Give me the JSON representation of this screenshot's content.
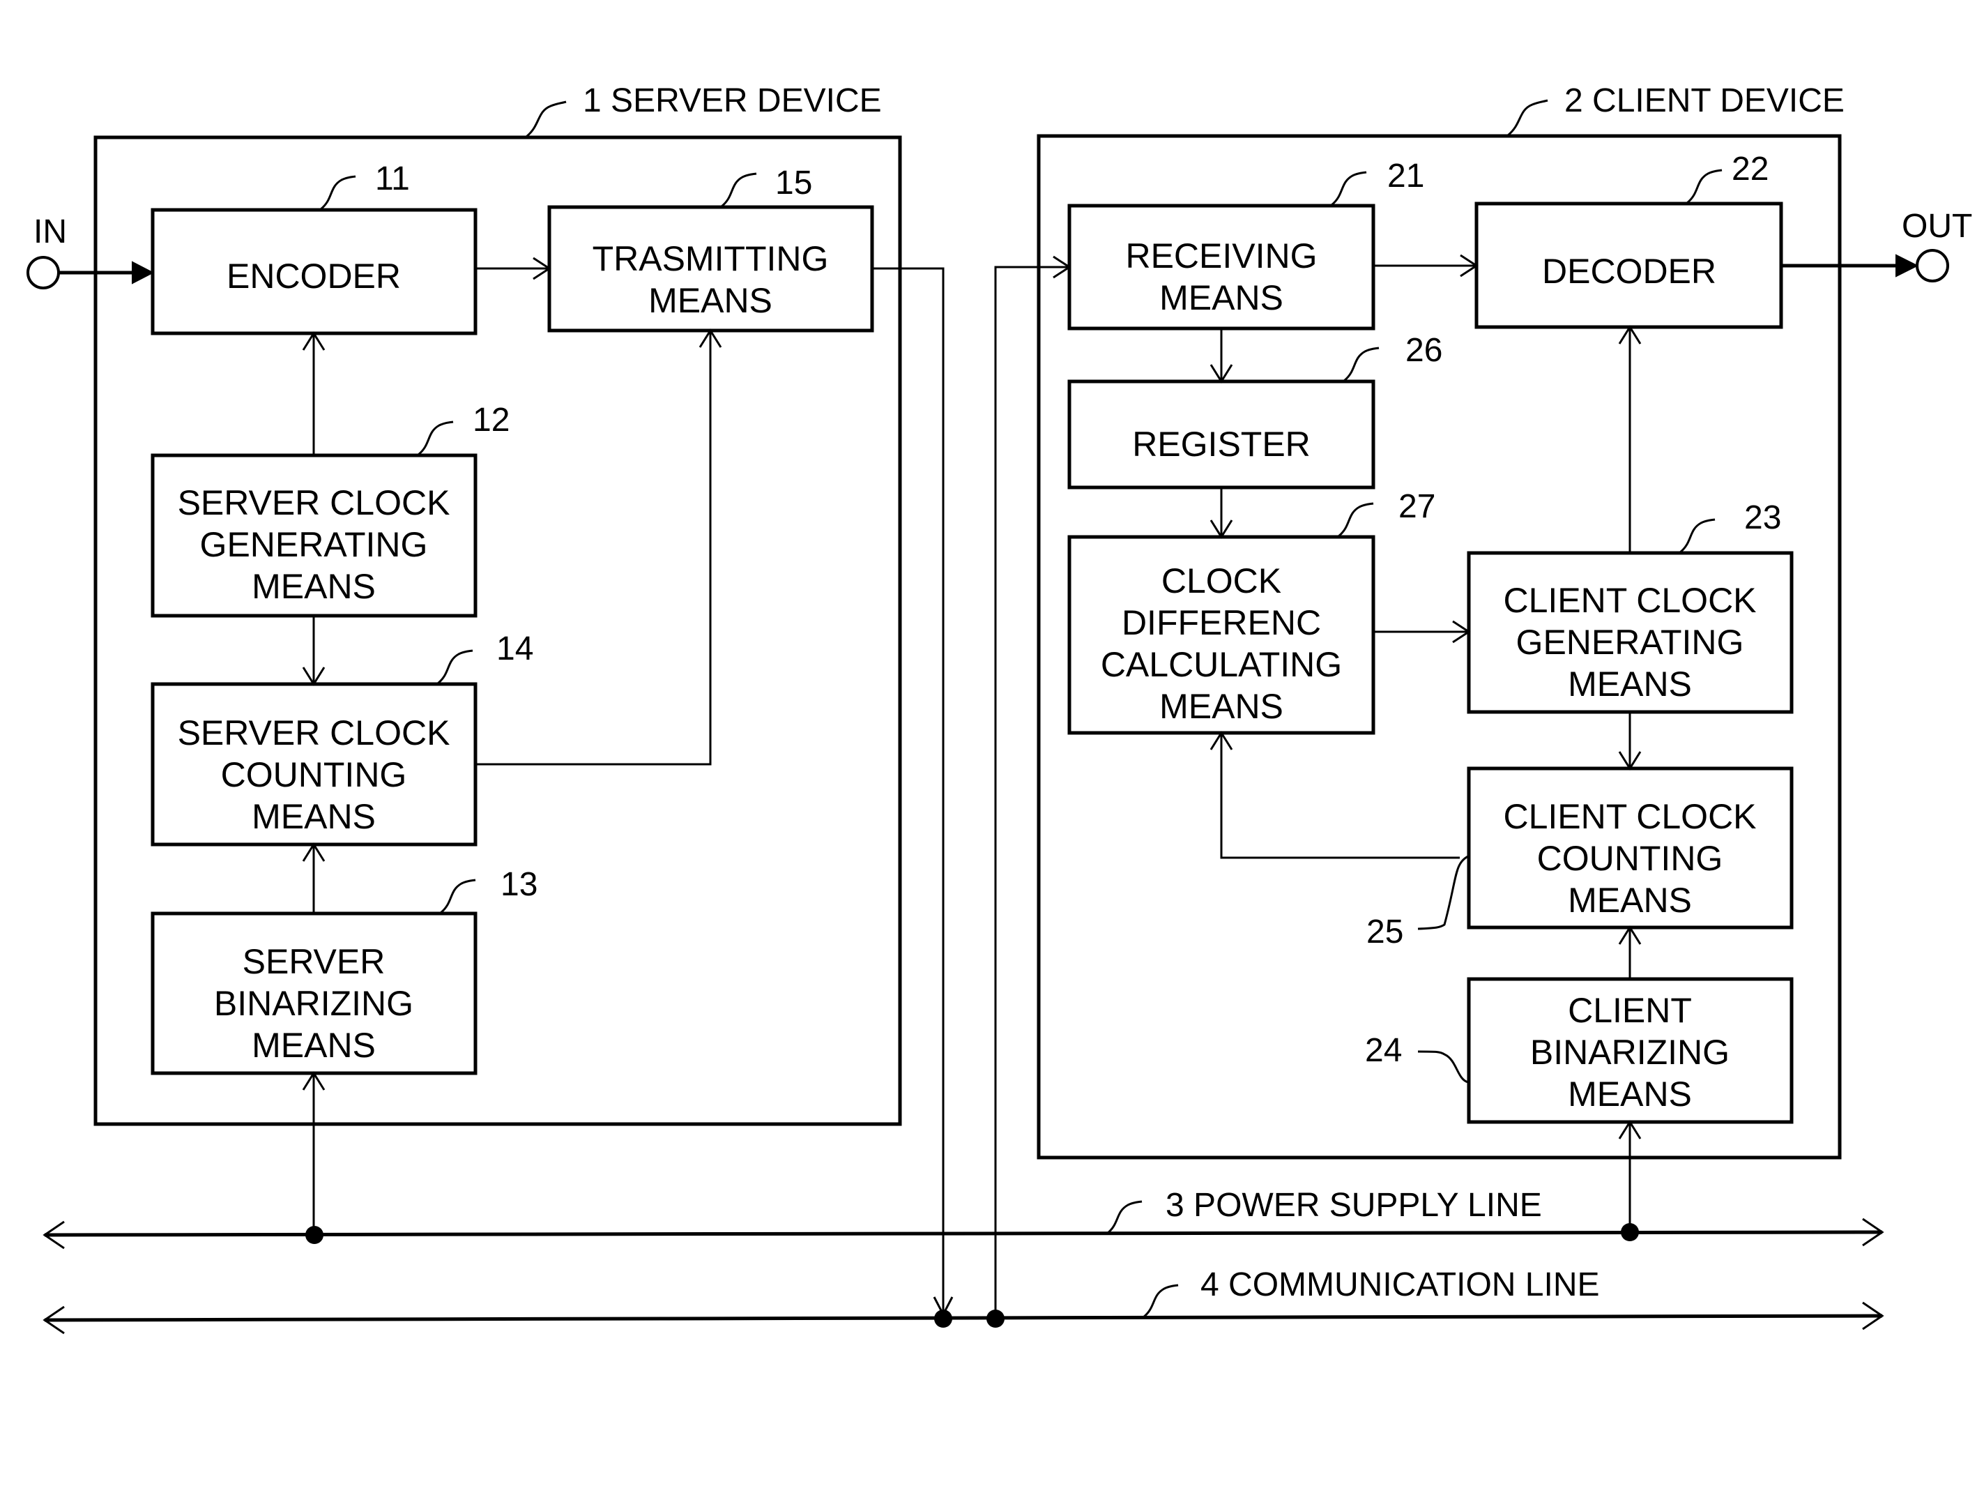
{
  "figure": {
    "devices": {
      "server": {
        "ref": "1",
        "label": "SERVER DEVICE"
      },
      "client": {
        "ref": "2",
        "label": "CLIENT DEVICE"
      }
    },
    "terminals": {
      "input": "IN",
      "output": "OUT"
    },
    "blocks": {
      "encoder": {
        "ref": "11",
        "lines": [
          "ENCODER"
        ]
      },
      "transmitting": {
        "ref": "15",
        "lines": [
          "TRASMITTING",
          "MEANS"
        ]
      },
      "server_clock_gen": {
        "ref": "12",
        "lines": [
          "SERVER CLOCK",
          "GENERATING",
          "MEANS"
        ]
      },
      "server_clock_count": {
        "ref": "14",
        "lines": [
          "SERVER CLOCK",
          "COUNTING",
          "MEANS"
        ]
      },
      "server_binarizing": {
        "ref": "13",
        "lines": [
          "SERVER",
          "BINARIZING",
          "MEANS"
        ]
      },
      "receiving": {
        "ref": "21",
        "lines": [
          "RECEIVING",
          "MEANS"
        ]
      },
      "decoder": {
        "ref": "22",
        "lines": [
          "DECODER"
        ]
      },
      "register": {
        "ref": "26",
        "lines": [
          "REGISTER"
        ]
      },
      "clock_diff": {
        "ref": "27",
        "lines": [
          "CLOCK",
          "DIFFERENC",
          "CALCULATING",
          "MEANS"
        ]
      },
      "client_clock_gen": {
        "ref": "23",
        "lines": [
          "CLIENT CLOCK",
          "GENERATING",
          "MEANS"
        ]
      },
      "client_clock_count": {
        "ref": "25",
        "lines": [
          "CLIENT CLOCK",
          "COUNTING",
          "MEANS"
        ]
      },
      "client_binarizing": {
        "ref": "24",
        "lines": [
          "CLIENT",
          "BINARIZING",
          "MEANS"
        ]
      }
    },
    "lines": {
      "power": {
        "ref": "3",
        "label": "POWER SUPPLY LINE"
      },
      "communication": {
        "ref": "4",
        "label": "COMMUNICATION LINE"
      }
    }
  }
}
